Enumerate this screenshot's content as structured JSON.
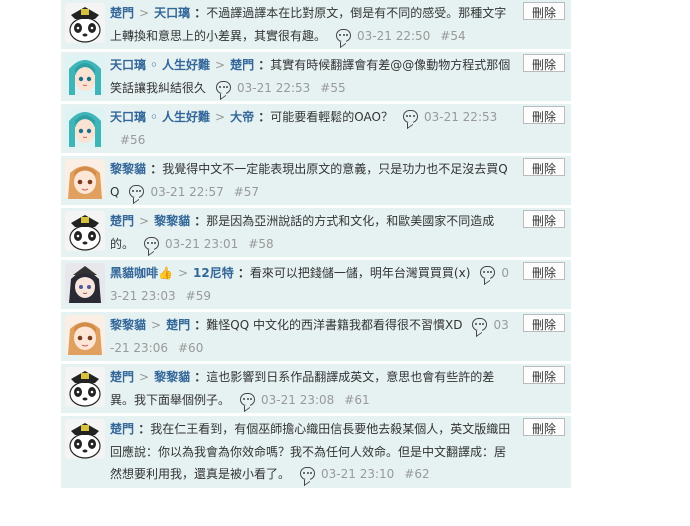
{
  "delete_label": "刪除",
  "comments": [
    {
      "avatar": "panda",
      "path": [
        {
          "name": "楚門"
        },
        {
          "name": "天口璃"
        }
      ],
      "text": "不過譯過譯本在比對原文，倒是有不同的感受。那種文字上轉換和意思上的小差異，其實很有趣。",
      "time": "03-21 22:50",
      "floor": "#54"
    },
    {
      "avatar": "miku",
      "path": [
        {
          "name": "天口璃 ◦ 人生好難"
        },
        {
          "name": "楚門"
        }
      ],
      "text": "其實有時候翻譯會有差@@像動物方程式那個笑話讓我糾結很久",
      "time": "03-21 22:53",
      "floor": "#55"
    },
    {
      "avatar": "miku",
      "path": [
        {
          "name": "天口璃 ◦ 人生好難"
        },
        {
          "name": "大帝"
        }
      ],
      "text": "可能要看輕鬆的OAO？",
      "time": "03-21 22:53",
      "floor": "#56"
    },
    {
      "avatar": "girl",
      "path": [
        {
          "name": "黎黎貓"
        }
      ],
      "text": "我覺得中文不一定能表現出原文的意義，只是功力也不足沒去買QQ",
      "time": "03-21 22:57",
      "floor": "#57"
    },
    {
      "avatar": "panda",
      "path": [
        {
          "name": "楚門"
        },
        {
          "name": "黎黎貓"
        }
      ],
      "text": "那是因為亞洲說話的方式和文化，和歐美國家不同造成的。",
      "time": "03-21 23:01",
      "floor": "#58"
    },
    {
      "avatar": "dark",
      "path": [
        {
          "name": "黑貓咖啡👍"
        },
        {
          "name": "12尼特"
        }
      ],
      "text": "看來可以把錢儲一儲，明年台灣買買買(x)",
      "time": "03-21 23:03",
      "floor": "#59"
    },
    {
      "avatar": "girl",
      "path": [
        {
          "name": "黎黎貓"
        },
        {
          "name": "楚門"
        }
      ],
      "text": "難怪QQ 中文化的西洋書籍我都看得很不習慣XD",
      "time": "03-21 23:06",
      "floor": "#60"
    },
    {
      "avatar": "panda",
      "path": [
        {
          "name": "楚門"
        },
        {
          "name": "黎黎貓"
        }
      ],
      "text": "這也影響到日系作品翻譯成英文，意思也會有些許的差異。我下面舉個例子。",
      "time": "03-21 23:08",
      "floor": "#61"
    },
    {
      "avatar": "panda",
      "path": [
        {
          "name": "楚門"
        }
      ],
      "text": "我在仁王看到，有個巫師擔心織田信長要他去殺某個人，英文版織田回應說：你以為我會為你效命嗎？我不為任何人效命。但是中文翻譯成：居然想要利用我，還真是被小看了。",
      "time": "03-21 23:10",
      "floor": "#62"
    }
  ]
}
